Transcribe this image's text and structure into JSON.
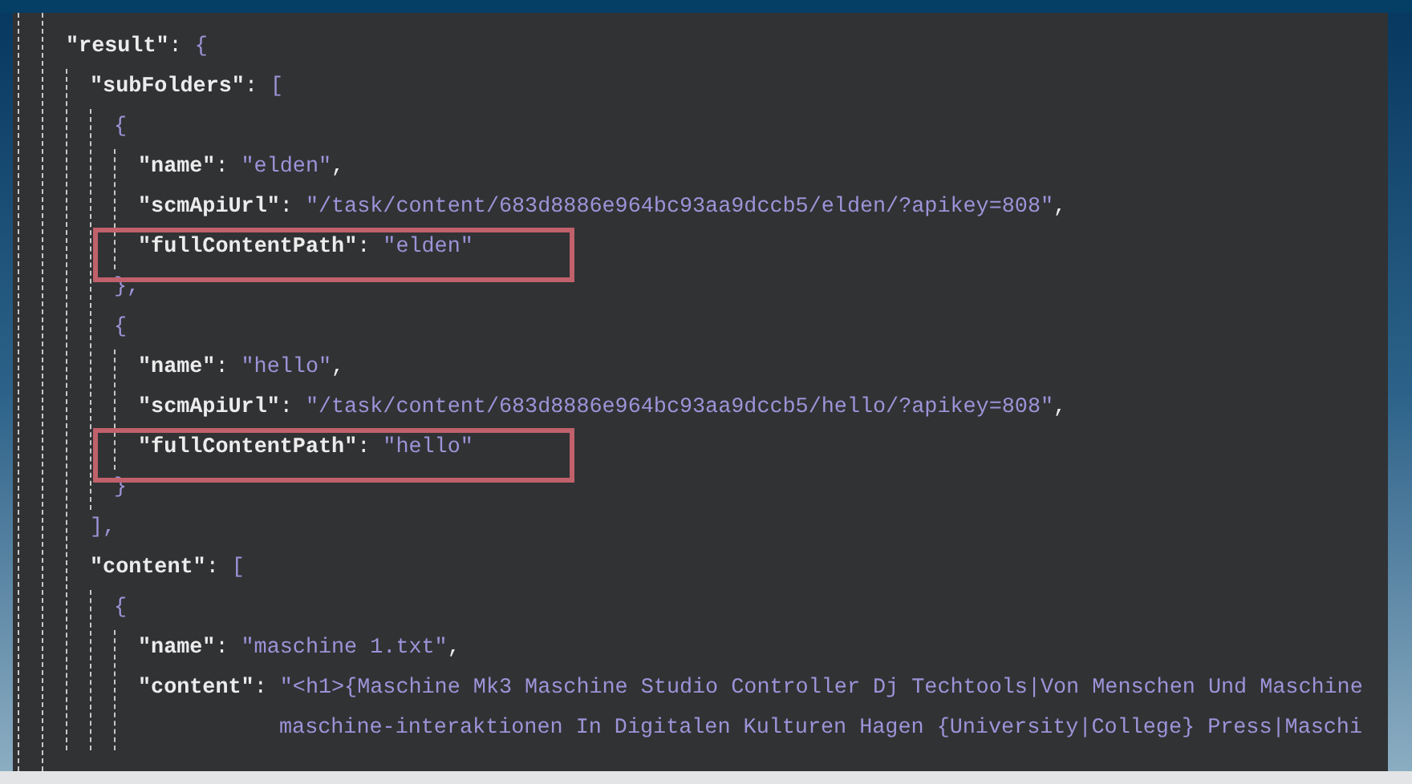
{
  "code_view": {
    "lines": [
      {
        "key": "\"result\"",
        "colon": ":",
        "value": "{",
        "children": [
          {
            "key": "\"subFolders\"",
            "colon": ":",
            "value": "[",
            "children": [
              {
                "value": "{",
                "close": "},",
                "children": [
                  {
                    "key": "\"name\"",
                    "colon": ":",
                    "value": "\"elden\"",
                    "suffix": ",",
                    "highlighted": false
                  },
                  {
                    "key": "\"scmApiUrl\"",
                    "colon": ":",
                    "value": "\"/task/content/683d8886e964bc93aa9dccb5/elden/?apikey=808\"",
                    "suffix": ",",
                    "highlighted": false
                  },
                  {
                    "key": "\"fullContentPath\"",
                    "colon": ":",
                    "value": "\"elden\"",
                    "highlighted": true
                  }
                ]
              },
              {
                "value": "{",
                "close": "}",
                "children": [
                  {
                    "key": "\"name\"",
                    "colon": ":",
                    "value": "\"hello\"",
                    "suffix": ",",
                    "highlighted": false
                  },
                  {
                    "key": "\"scmApiUrl\"",
                    "colon": ":",
                    "value": "\"/task/content/683d8886e964bc93aa9dccb5/hello/?apikey=808\"",
                    "suffix": ",",
                    "highlighted": false
                  },
                  {
                    "key": "\"fullContentPath\"",
                    "colon": ":",
                    "value": "\"hello\"",
                    "highlighted": true
                  }
                ]
              }
            ],
            "close": "],"
          },
          {
            "key": "\"content\"",
            "colon": ":",
            "value": "[",
            "children": [
              {
                "value": "{",
                "children": [
                  {
                    "key": "\"name\"",
                    "colon": ":",
                    "value": "\"maschine 1.txt\"",
                    "suffix": ",",
                    "highlighted": false
                  },
                  {
                    "key": "\"content\"",
                    "colon": ":",
                    "value": "\"<h1>{Maschine Mk3 Maschine Studio Controller Dj Techtools|Von Menschen Und Maschine",
                    "continuation": [
                      "maschine-interaktionen In Digitalen Kulturen Hagen {University|College} Press|Maschi"
                    ],
                    "highlighted": false
                  }
                ]
              }
            ]
          }
        ]
      }
    ]
  }
}
